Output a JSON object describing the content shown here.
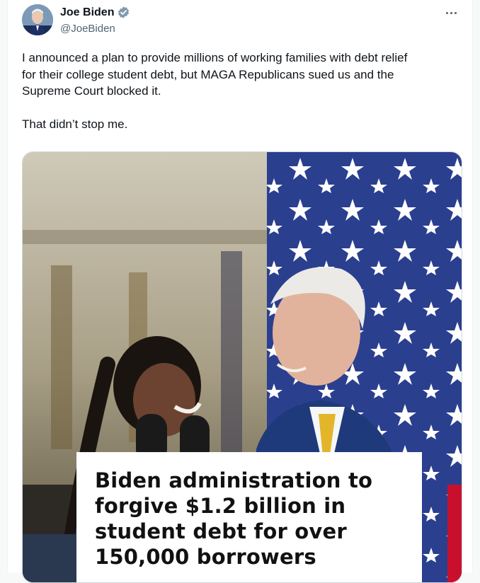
{
  "author": {
    "display_name": "Joe Biden",
    "handle": "@JoeBiden",
    "verified_icon": "verified-badge-icon",
    "verified_color": "#829aab"
  },
  "tweet": {
    "text": "I announced a plan to provide millions of working families with debt relief\nfor their college student debt, but MAGA Republicans sued us and the\nSupreme Court blocked it.\n\nThat didn’t stop me."
  },
  "media": {
    "headline": "Biden administration to\nforgive $1.2 billion in\nstudent debt for over\n150,000 borrowers"
  },
  "colors": {
    "flag_blue": "#2b3f8f",
    "flag_red": "#c8102e",
    "handle_gray": "#536471"
  }
}
